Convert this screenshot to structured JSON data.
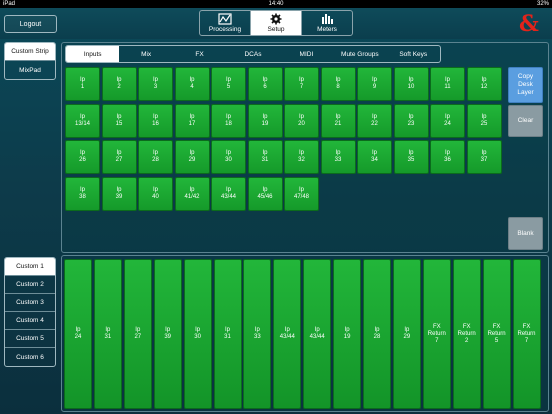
{
  "status": {
    "device": "iPad",
    "time": "14:40",
    "battery": "32%"
  },
  "header": {
    "logout_label": "Logout",
    "logo_text": "&"
  },
  "main_tabs": [
    {
      "label": "Processing",
      "icon": "processing-icon",
      "active": false
    },
    {
      "label": "Setup",
      "icon": "gear-icon",
      "active": true
    },
    {
      "label": "Meters",
      "icon": "meters-icon",
      "active": false
    }
  ],
  "sidebar": {
    "top_items": [
      {
        "label": "Custom Strip",
        "active": true
      },
      {
        "label": "MixPad",
        "active": false
      }
    ]
  },
  "custom_list": [
    {
      "label": "Custom 1",
      "active": true
    },
    {
      "label": "Custom 2",
      "active": false
    },
    {
      "label": "Custom 3",
      "active": false
    },
    {
      "label": "Custom 4",
      "active": false
    },
    {
      "label": "Custom 5",
      "active": false
    },
    {
      "label": "Custom 6",
      "active": false
    }
  ],
  "subtabs": [
    {
      "label": "Inputs",
      "active": true
    },
    {
      "label": "Mix",
      "active": false
    },
    {
      "label": "FX",
      "active": false
    },
    {
      "label": "DCAs",
      "active": false
    },
    {
      "label": "MIDI",
      "active": false
    },
    {
      "label": "Mute Groups",
      "active": false
    },
    {
      "label": "Soft Keys",
      "active": false
    }
  ],
  "inputs": [
    "Ip\n1",
    "Ip\n2",
    "Ip\n3",
    "Ip\n4",
    "Ip\n5",
    "Ip\n6",
    "Ip\n7",
    "Ip\n8",
    "Ip\n9",
    "Ip\n10",
    "Ip\n11",
    "Ip\n12",
    "Ip\n13/14",
    "Ip\n15",
    "Ip\n16",
    "Ip\n17",
    "Ip\n18",
    "Ip\n19",
    "Ip\n20",
    "Ip\n21",
    "Ip\n22",
    "Ip\n23",
    "Ip\n24",
    "Ip\n25",
    "Ip\n26",
    "Ip\n27",
    "Ip\n28",
    "Ip\n29",
    "Ip\n30",
    "Ip\n31",
    "Ip\n32",
    "Ip\n33",
    "Ip\n34",
    "Ip\n35",
    "Ip\n36",
    "Ip\n37",
    "Ip\n38",
    "Ip\n39",
    "Ip\n40",
    "Ip\n41/42",
    "Ip\n43/44",
    "Ip\n45/46",
    "Ip\n47/48"
  ],
  "actions": {
    "copy_label": "Copy\nDesk\nLayer",
    "clear_label": "Clear",
    "blank_label": "Blank"
  },
  "strips": [
    "Ip\n24",
    "Ip\n31",
    "Ip\n27",
    "Ip\n39",
    "Ip\n30",
    "Ip\n31",
    "Ip\n33",
    "Ip\n43/44",
    "Ip\n43/44",
    "Ip\n19",
    "Ip\n28",
    "Ip\n29",
    "FX Return\n7",
    "FX Return\n2",
    "FX Return\n5",
    "FX Return\n7"
  ],
  "colors": {
    "button_green": "#1fae35",
    "copy_blue": "#5a9ee0",
    "clear_grey": "#8a9ba2",
    "logo_red": "#e2231a"
  }
}
